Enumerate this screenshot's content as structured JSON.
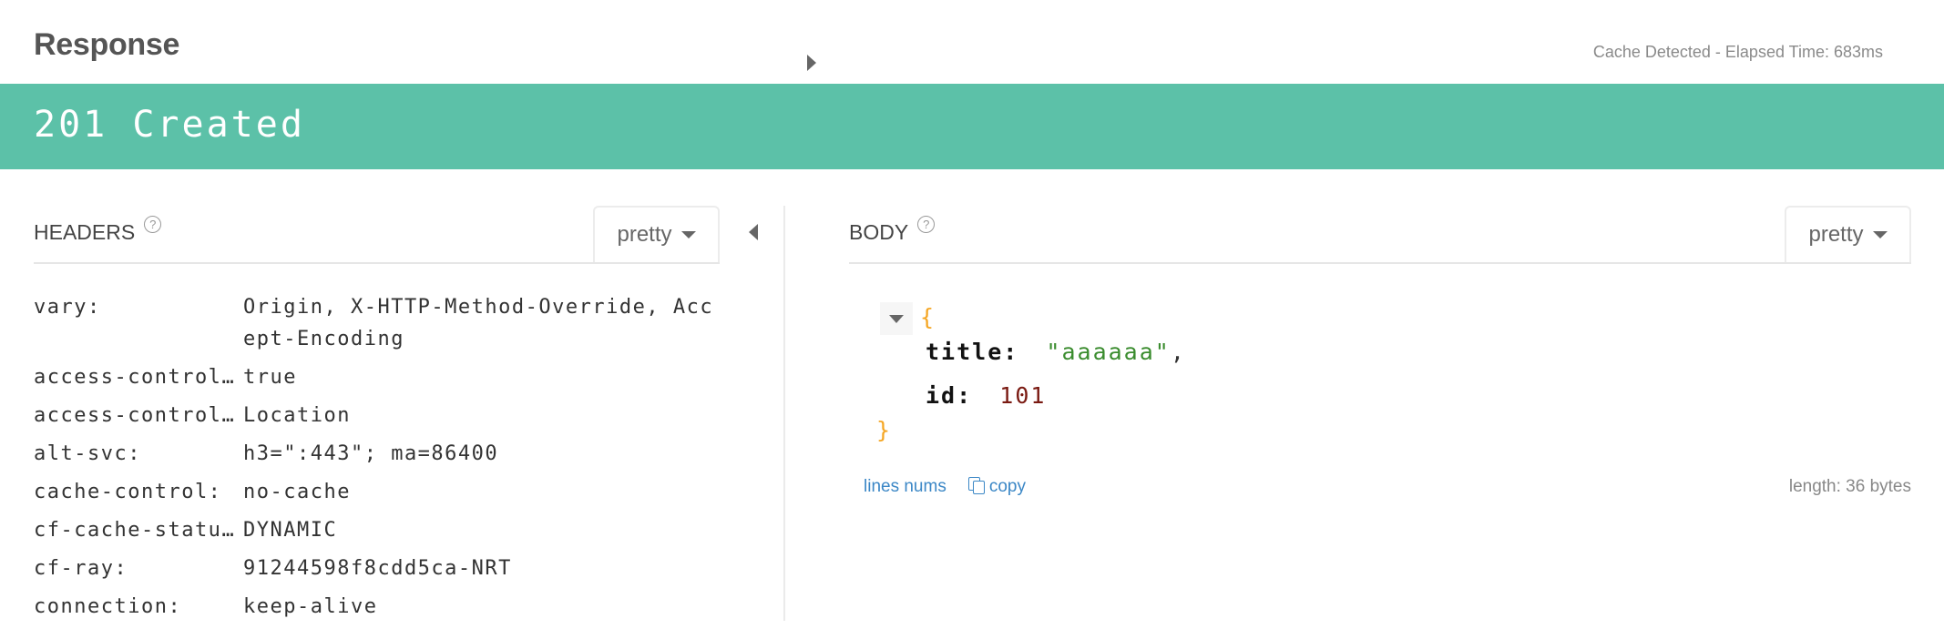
{
  "header": {
    "title": "Response",
    "meta": "Cache Detected - Elapsed Time: 683ms"
  },
  "status": {
    "text": "201 Created",
    "color": "#5cc1a8"
  },
  "headers_panel": {
    "title": "HEADERS",
    "help_icon": "?",
    "format": "pretty",
    "collapse_icon": "caret-left",
    "rows": [
      {
        "key": "vary:",
        "value": "Origin, X-HTTP-Method-Override, Accept-Encoding"
      },
      {
        "key": "access-control-allow-credentials:",
        "value": "true"
      },
      {
        "key": "access-control-expose-headers:",
        "value": "Location"
      },
      {
        "key": "alt-svc:",
        "value": "h3=\":443\"; ma=86400"
      },
      {
        "key": "cache-control:",
        "value": "no-cache"
      },
      {
        "key": "cf-cache-status:",
        "value": "DYNAMIC"
      },
      {
        "key": "cf-ray:",
        "value": "91244598f8cdd5ca-NRT"
      },
      {
        "key": "connection:",
        "value": "keep-alive"
      }
    ]
  },
  "body_panel": {
    "title": "BODY",
    "help_icon": "?",
    "format": "pretty",
    "expand_icon": "caret-right",
    "json": {
      "open_brace": "{",
      "close_brace": "}",
      "fields": [
        {
          "key": "title:",
          "value": "\"aaaaaa\"",
          "type": "string",
          "trailing": ","
        },
        {
          "key": "id:",
          "value": "101",
          "type": "number",
          "trailing": ""
        }
      ]
    },
    "footer": {
      "line_nums": "lines nums",
      "copy": "copy",
      "length": "length: 36 bytes"
    }
  }
}
